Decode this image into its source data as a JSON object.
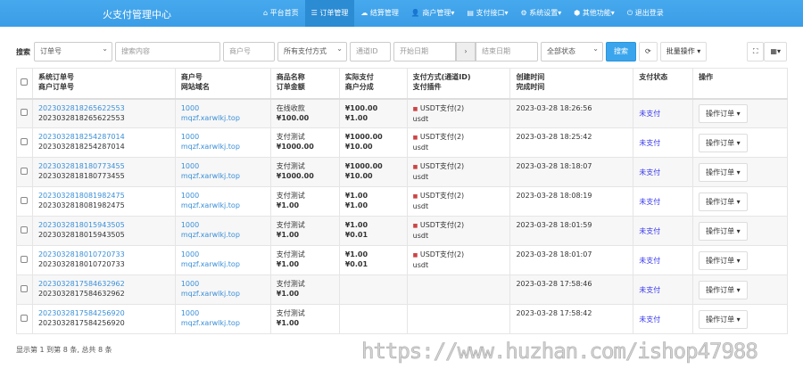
{
  "header": {
    "brand": "火支付管理中心",
    "menu": [
      {
        "icon": "home-icon",
        "glyph": "⌂",
        "label": "平台首页"
      },
      {
        "icon": "list-icon",
        "glyph": "☰",
        "label": "订单管理",
        "active": true
      },
      {
        "icon": "cloud-icon",
        "glyph": "☁",
        "label": "结算管理"
      },
      {
        "icon": "user-icon",
        "glyph": "👤",
        "label": "商户管理▾"
      },
      {
        "icon": "card-icon",
        "glyph": "▤",
        "label": "支付接口▾"
      },
      {
        "icon": "gear-icon",
        "glyph": "⚙",
        "label": "系统设置▾"
      },
      {
        "icon": "cube-icon",
        "glyph": "⬢",
        "label": "其他功能▾"
      },
      {
        "icon": "power-icon",
        "glyph": "⏻",
        "label": "退出登录"
      }
    ]
  },
  "toolbar": {
    "search_label": "搜索",
    "type_select": "订单号",
    "keyword_placeholder": "搜索内容",
    "merchant_placeholder": "商户号",
    "paytype_select": "所有支付方式",
    "channel_placeholder": "通道ID",
    "start_placeholder": "开始日期",
    "range_sep": "›",
    "end_placeholder": "结束日期",
    "status_select": "全部状态",
    "search_button": "搜索",
    "refresh_glyph": "⟳",
    "batch_button": "批量操作 ▾",
    "fullscreen_glyph": "⛶",
    "columns_glyph": "▦▾"
  },
  "table": {
    "headers": [
      [
        "系统订单号",
        "商户订单号"
      ],
      [
        "商户号",
        "网站域名"
      ],
      [
        "商品名称",
        "订单金额"
      ],
      [
        "实际支付",
        "商户分成"
      ],
      [
        "支付方式(通道ID)",
        "支付插件"
      ],
      [
        "创建时间",
        "完成时间"
      ],
      [
        "",
        "支付状态"
      ],
      [
        "",
        "操作"
      ]
    ],
    "rows": [
      {
        "trade_no": "2023032818265622553",
        "out_trade_no": "2023032818265622553",
        "uid": "1000",
        "domain": "mqzf.xarwlkj.top",
        "name": "在线收款",
        "money": "¥100.00",
        "realmoney": "¥100.00",
        "getmoney": "¥1.00",
        "paytype": "USDT支付(2)",
        "plugin": "usdt",
        "addtime": "2023-03-28 18:26:56",
        "status": "未支付",
        "op": "操作订单 ▾"
      },
      {
        "trade_no": "2023032818254287014",
        "out_trade_no": "2023032818254287014",
        "uid": "1000",
        "domain": "mqzf.xarwlkj.top",
        "name": "支付测试",
        "money": "¥1000.00",
        "realmoney": "¥1000.00",
        "getmoney": "¥10.00",
        "paytype": "USDT支付(2)",
        "plugin": "usdt",
        "addtime": "2023-03-28 18:25:42",
        "status": "未支付",
        "op": "操作订单 ▾"
      },
      {
        "trade_no": "2023032818180773455",
        "out_trade_no": "2023032818180773455",
        "uid": "1000",
        "domain": "mqzf.xarwlkj.top",
        "name": "支付测试",
        "money": "¥1000.00",
        "realmoney": "¥1000.00",
        "getmoney": "¥10.00",
        "paytype": "USDT支付(2)",
        "plugin": "usdt",
        "addtime": "2023-03-28 18:18:07",
        "status": "未支付",
        "op": "操作订单 ▾"
      },
      {
        "trade_no": "2023032818081982475",
        "out_trade_no": "2023032818081982475",
        "uid": "1000",
        "domain": "mqzf.xarwlkj.top",
        "name": "支付测试",
        "money": "¥1.00",
        "realmoney": "¥1.00",
        "getmoney": "¥1.00",
        "paytype": "USDT支付(2)",
        "plugin": "usdt",
        "addtime": "2023-03-28 18:08:19",
        "status": "未支付",
        "op": "操作订单 ▾"
      },
      {
        "trade_no": "2023032818015943505",
        "out_trade_no": "2023032818015943505",
        "uid": "1000",
        "domain": "mqzf.xarwlkj.top",
        "name": "支付测试",
        "money": "¥1.00",
        "realmoney": "¥1.00",
        "getmoney": "¥0.01",
        "paytype": "USDT支付(2)",
        "plugin": "usdt",
        "addtime": "2023-03-28 18:01:59",
        "status": "未支付",
        "op": "操作订单 ▾"
      },
      {
        "trade_no": "2023032818010720733",
        "out_trade_no": "2023032818010720733",
        "uid": "1000",
        "domain": "mqzf.xarwlkj.top",
        "name": "支付测试",
        "money": "¥1.00",
        "realmoney": "¥1.00",
        "getmoney": "¥0.01",
        "paytype": "USDT支付(2)",
        "plugin": "usdt",
        "addtime": "2023-03-28 18:01:07",
        "status": "未支付",
        "op": "操作订单 ▾"
      },
      {
        "trade_no": "2023032817584632962",
        "out_trade_no": "2023032817584632962",
        "uid": "1000",
        "domain": "mqzf.xarwlkj.top",
        "name": "支付测试",
        "money": "¥1.00",
        "realmoney": "",
        "getmoney": "",
        "paytype": "",
        "plugin": "",
        "addtime": "2023-03-28 17:58:46",
        "status": "未支付",
        "op": "操作订单 ▾"
      },
      {
        "trade_no": "2023032817584256920",
        "out_trade_no": "2023032817584256920",
        "uid": "1000",
        "domain": "mqzf.xarwlkj.top",
        "name": "支付测试",
        "money": "¥1.00",
        "realmoney": "",
        "getmoney": "",
        "paytype": "",
        "plugin": "",
        "addtime": "2023-03-28 17:58:42",
        "status": "未支付",
        "op": "操作订单 ▾"
      }
    ]
  },
  "footer": {
    "summary": "显示第 1 到第 8 条, 总共 8 条"
  },
  "watermark": "https://www.huzhan.com/ishop47988",
  "colors": {
    "nav": "#3ea2ea",
    "link": "#3a8fd8",
    "status_unpaid": "#3a3aee",
    "primary_button": "#3aa5ec"
  }
}
